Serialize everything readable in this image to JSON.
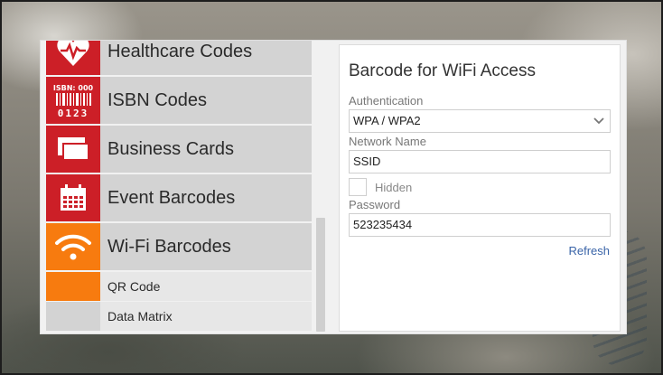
{
  "categories": [
    {
      "label": "Healthcare Codes",
      "icon": "heart-pulse-icon"
    },
    {
      "label": "ISBN Codes",
      "icon": "isbn-barcode-icon",
      "icon_text_top": "ISBN: 000",
      "icon_text_bottom": "0123"
    },
    {
      "label": "Business Cards",
      "icon": "business-cards-icon"
    },
    {
      "label": "Event Barcodes",
      "icon": "calendar-icon"
    },
    {
      "label": "Wi-Fi Barcodes",
      "icon": "wifi-icon",
      "active": true
    }
  ],
  "subitems": [
    {
      "label": "QR Code",
      "active": true
    },
    {
      "label": "Data Matrix",
      "active": false
    }
  ],
  "form": {
    "title": "Barcode for WiFi Access",
    "auth_label": "Authentication",
    "auth_value": "WPA / WPA2",
    "network_label": "Network Name",
    "network_value": "SSID",
    "hidden_label": "Hidden",
    "hidden_checked": false,
    "password_label": "Password",
    "password_value": "523235434",
    "refresh_label": "Refresh"
  },
  "colors": {
    "category_icon_bg": "#cc1f27",
    "active_accent": "#f77b0f",
    "link": "#3a64a8"
  }
}
